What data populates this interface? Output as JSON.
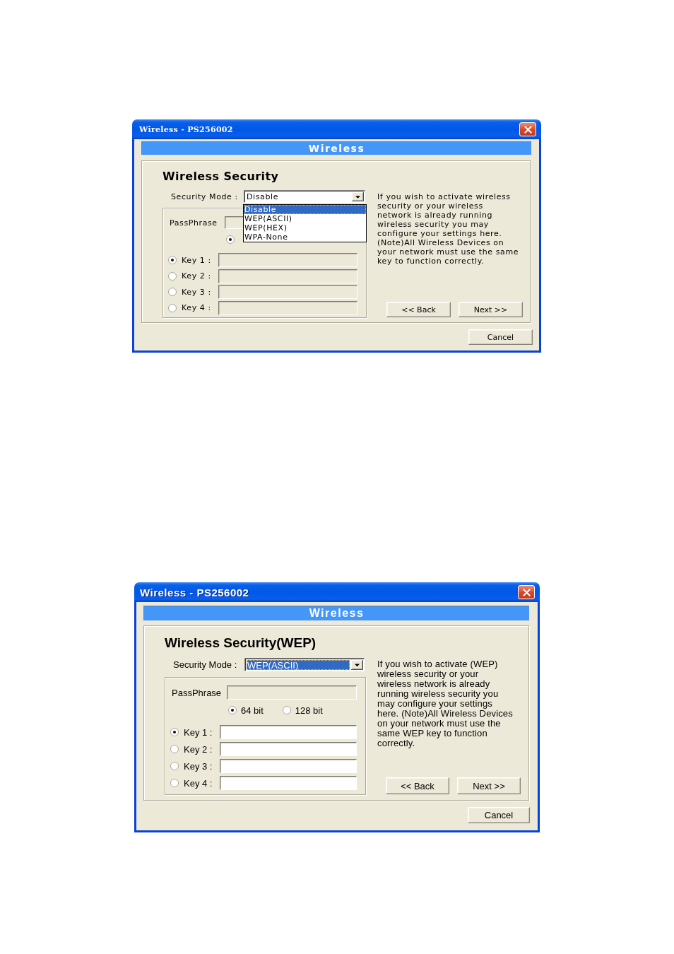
{
  "dialogs": [
    {
      "title": "Wireless - PS256002",
      "banner": "Wireless",
      "heading": "Wireless Security",
      "security_mode": {
        "label": "Security Mode :",
        "value": "Disable",
        "focused": false,
        "options": [
          {
            "label": "Disable",
            "selected": true
          },
          {
            "label": "WEP(ASCII)",
            "selected": false
          },
          {
            "label": "WEP(HEX)",
            "selected": false
          },
          {
            "label": "WPA-None",
            "selected": false
          }
        ]
      },
      "passphrase": {
        "label": "PassPhrase",
        "disabled": true
      },
      "bit_options": [
        {
          "selected": true
        }
      ],
      "keys": [
        {
          "label": "Key 1 :",
          "selected": true,
          "disabled": true
        },
        {
          "label": "Key 2 :",
          "selected": false,
          "disabled": true
        },
        {
          "label": "Key 3 :",
          "selected": false,
          "disabled": true
        },
        {
          "label": "Key 4 :",
          "selected": false,
          "disabled": true
        }
      ],
      "description": "If you wish to activate wireless security or your wireless network is already running wireless security you may configure your settings here. (Note)All Wireless Devices on your network must use the same key to function correctly.",
      "buttons": [
        {
          "kind": "back",
          "label": "<< Back"
        },
        {
          "kind": "next",
          "label": "Next >>"
        },
        {
          "kind": "cancel",
          "label": "Cancel"
        }
      ]
    },
    {
      "title": "Wireless - PS256002",
      "banner": "Wireless",
      "heading": "Wireless Security(WEP)",
      "security_mode": {
        "label": "Security Mode :",
        "value": "WEP(ASCII)",
        "focused": true
      },
      "passphrase": {
        "label": "PassPhrase",
        "disabled": true
      },
      "bit_options": [
        {
          "label": "64 bit",
          "selected": true
        },
        {
          "label": "128 bit",
          "selected": false
        }
      ],
      "keys": [
        {
          "label": "Key 1 :",
          "selected": true,
          "disabled": false
        },
        {
          "label": "Key 2 :",
          "selected": false,
          "disabled": false
        },
        {
          "label": "Key 3 :",
          "selected": false,
          "disabled": false
        },
        {
          "label": "Key 4 :",
          "selected": false,
          "disabled": false
        }
      ],
      "description": "If you wish to activate (WEP) wireless security or your wireless network is already running wireless security you may configure your settings here. (Note)All Wireless Devices on your network must use the same WEP key to function correctly.",
      "buttons": [
        {
          "kind": "back",
          "label": "<< Back"
        },
        {
          "kind": "next",
          "label": "Next >>"
        },
        {
          "kind": "cancel",
          "label": "Cancel"
        }
      ]
    }
  ]
}
